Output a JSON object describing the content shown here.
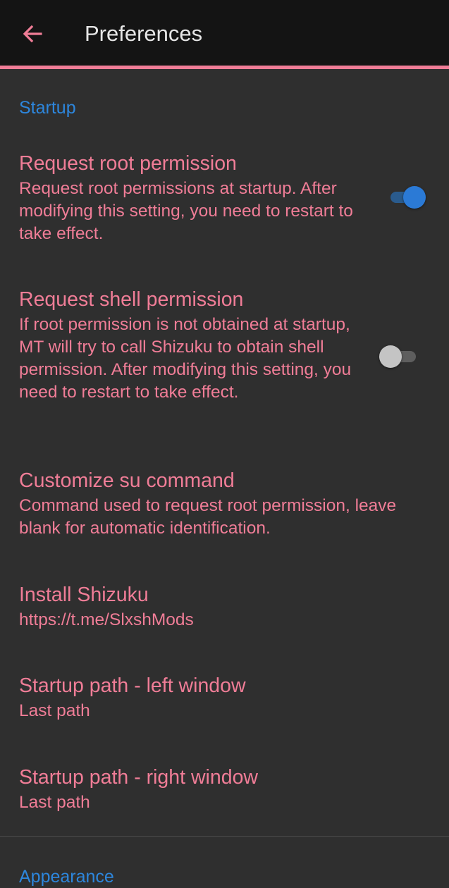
{
  "header": {
    "title": "Preferences",
    "back_icon": "arrow-left-icon",
    "accent_color": "#f07d97"
  },
  "sections": [
    {
      "header": "Startup",
      "items": [
        {
          "title": "Request root permission",
          "summary": "Request root permissions at startup. After modifying this setting, you need to restart to take effect.",
          "switch": true
        },
        {
          "title": "Request shell permission",
          "summary": "If root permission is not obtained at startup, MT will try to call Shizuku to obtain shell permission. After modifying this setting, you need to restart to take effect.",
          "switch": false
        },
        {
          "title": "Customize su command",
          "summary": "Command used to request root permission, leave blank for automatic identification."
        },
        {
          "title": "Install Shizuku",
          "summary": "https://t.me/SlxshMods"
        },
        {
          "title": "Startup path - left window",
          "summary": "Last path"
        },
        {
          "title": "Startup path - right window",
          "summary": "Last path"
        }
      ]
    },
    {
      "header": "Appearance"
    }
  ],
  "colors": {
    "background": "#2f2f2f",
    "toolbar": "#141414",
    "item_text": "#f07d97",
    "section_header": "#2d86dc",
    "switch_on": "#2b7ad6"
  }
}
